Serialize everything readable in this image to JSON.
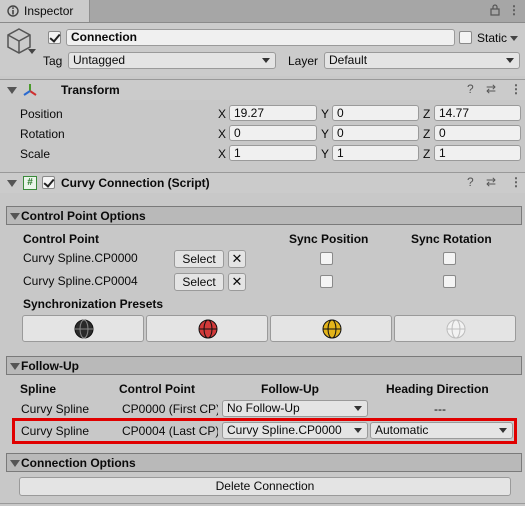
{
  "tab": {
    "title": "Inspector"
  },
  "gameobject": {
    "active": true,
    "name": "Connection",
    "static_label": "Static",
    "static_checked": false,
    "tag_label": "Tag",
    "tag_value": "Untagged",
    "layer_label": "Layer",
    "layer_value": "Default"
  },
  "transform": {
    "title": "Transform",
    "rows": [
      {
        "label": "Position",
        "x": "19.27",
        "y": "0",
        "z": "14.77"
      },
      {
        "label": "Rotation",
        "x": "0",
        "y": "0",
        "z": "0"
      },
      {
        "label": "Scale",
        "x": "1",
        "y": "1",
        "z": "1"
      }
    ],
    "axis": {
      "x": "X",
      "y": "Y",
      "z": "Z"
    }
  },
  "script": {
    "title": "Curvy Connection (Script)",
    "enabled": true,
    "hash_icon": "#"
  },
  "control_point_options": {
    "title": "Control Point Options",
    "col_control_point": "Control Point",
    "col_sync_position": "Sync Position",
    "col_sync_rotation": "Sync Rotation",
    "rows": [
      {
        "name": "Curvy Spline.CP0000",
        "select": "Select",
        "remove": "✕",
        "sync_pos": false,
        "sync_rot": false
      },
      {
        "name": "Curvy Spline.CP0004",
        "select": "Select",
        "remove": "✕",
        "sync_pos": false,
        "sync_rot": false
      }
    ],
    "presets_label": "Synchronization Presets",
    "presets": [
      {
        "icon": "sync-preset-black-icon",
        "color": "#2a2a2a"
      },
      {
        "icon": "sync-preset-red-icon",
        "color": "#d23a3a"
      },
      {
        "icon": "sync-preset-yellow-icon",
        "color": "#e3b41a"
      },
      {
        "icon": "sync-preset-white-icon",
        "color": "#f2f2f2"
      }
    ]
  },
  "follow_up": {
    "title": "Follow-Up",
    "col_spline": "Spline",
    "col_control_point": "Control Point",
    "col_follow_up": "Follow-Up",
    "col_heading": "Heading Direction",
    "rows": [
      {
        "spline": "Curvy Spline",
        "control_point": "CP0000 (First CP)",
        "follow_up": "No Follow-Up",
        "heading": "---",
        "highlighted": false
      },
      {
        "spline": "Curvy Spline",
        "control_point": "CP0004 (Last CP)",
        "follow_up": "Curvy Spline.CP0000",
        "heading": "Automatic",
        "highlighted": true
      }
    ],
    "highlight_color": "#e00000"
  },
  "connection_options": {
    "title": "Connection Options",
    "delete_button": "Delete Connection"
  },
  "header_icons": {
    "help": "?",
    "settings": "⇄",
    "more": "⋮",
    "lock": "🔒"
  }
}
